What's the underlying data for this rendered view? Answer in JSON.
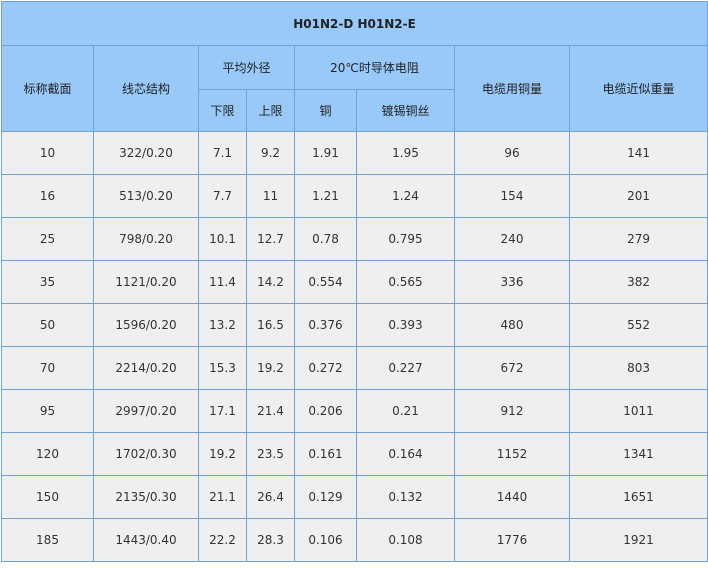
{
  "table": {
    "title": "H01N2-D H01N2-E",
    "headers": {
      "section": "标称截面",
      "structure": "线芯结构",
      "avg_diameter": "平均外径",
      "lower": "下限",
      "upper": "上限",
      "resistance": "20℃时导体电阻",
      "copper": "铜",
      "tinned": "镀锡铜丝",
      "copper_weight": "电缆用铜量",
      "cable_weight": "电缆近似重量"
    },
    "rows": [
      [
        "10",
        "322/0.20",
        "7.1",
        "9.2",
        "1.91",
        "1.95",
        "96",
        "141"
      ],
      [
        "16",
        "513/0.20",
        "7.7",
        "11",
        "1.21",
        "1.24",
        "154",
        "201"
      ],
      [
        "25",
        "798/0.20",
        "10.1",
        "12.7",
        "0.78",
        "0.795",
        "240",
        "279"
      ],
      [
        "35",
        "1121/0.20",
        "11.4",
        "14.2",
        "0.554",
        "0.565",
        "336",
        "382"
      ],
      [
        "50",
        "1596/0.20",
        "13.2",
        "16.5",
        "0.376",
        "0.393",
        "480",
        "552"
      ],
      [
        "70",
        "2214/0.20",
        "15.3",
        "19.2",
        "0.272",
        "0.227",
        "672",
        "803"
      ],
      [
        "95",
        "2997/0.20",
        "17.1",
        "21.4",
        "0.206",
        "0.21",
        "912",
        "1011"
      ],
      [
        "120",
        "1702/0.30",
        "19.2",
        "23.5",
        "0.161",
        "0.164",
        "1152",
        "1341"
      ],
      [
        "150",
        "2135/0.30",
        "21.1",
        "26.4",
        "0.129",
        "0.132",
        "1440",
        "1651"
      ],
      [
        "185",
        "1443/0.40",
        "22.2",
        "28.3",
        "0.106",
        "0.108",
        "1776",
        "1921"
      ]
    ]
  },
  "colors": {
    "header_bg": "#99c9f9",
    "border": "#6fa3d8",
    "cell_bg": "#efefef"
  }
}
